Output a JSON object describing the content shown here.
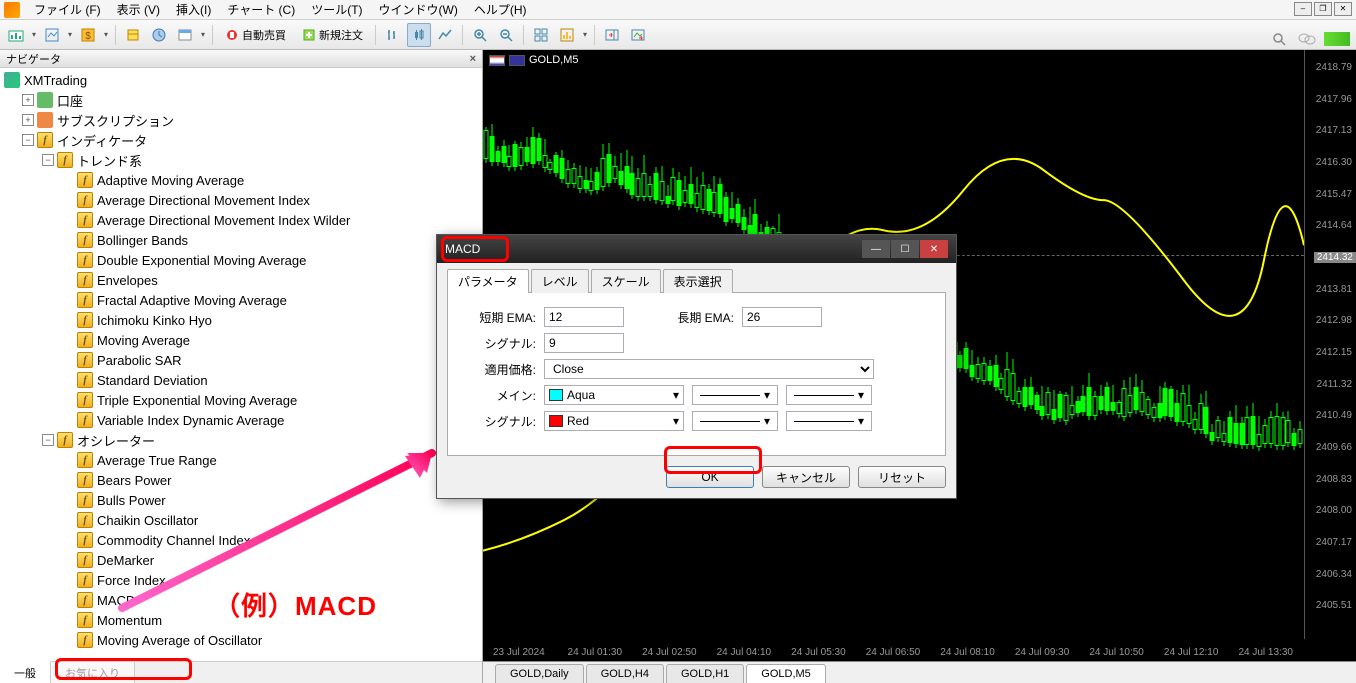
{
  "menu": {
    "items": [
      "ファイル (F)",
      "表示 (V)",
      "挿入(I)",
      "チャート (C)",
      "ツール(T)",
      "ウインドウ(W)",
      "ヘルプ(H)"
    ]
  },
  "toolbar": {
    "auto_trade": "自動売買",
    "new_order": "新規注文"
  },
  "navigator": {
    "title": "ナビゲータ",
    "root": "XMTrading",
    "account": "口座",
    "subscription": "サブスクリプション",
    "indicators": "インディケータ",
    "trend": "トレンド系",
    "oscillator": "オシレーター",
    "trend_items": [
      "Adaptive Moving Average",
      "Average Directional Movement Index",
      "Average Directional Movement Index Wilder",
      "Bollinger Bands",
      "Double Exponential Moving Average",
      "Envelopes",
      "Fractal Adaptive Moving Average",
      "Ichimoku Kinko Hyo",
      "Moving Average",
      "Parabolic SAR",
      "Standard Deviation",
      "Triple Exponential Moving Average",
      "Variable Index Dynamic Average"
    ],
    "osc_items": [
      "Average True Range",
      "Bears Power",
      "Bulls Power",
      "Chaikin Oscillator",
      "Commodity Channel Index",
      "DeMarker",
      "Force Index",
      "MACD",
      "Momentum",
      "Moving Average of Oscillator"
    ],
    "tab_general": "一般",
    "tab_favorites": "お気に入り"
  },
  "chart": {
    "title": "GOLD,M5",
    "prices": [
      "2418.79",
      "2417.96",
      "2417.13",
      "2416.30",
      "2415.47",
      "2414.64",
      "2414.32",
      "2413.81",
      "2412.98",
      "2412.15",
      "2411.32",
      "2410.49",
      "2409.66",
      "2408.83",
      "2408.00",
      "2407.17",
      "2406.34",
      "2405.51"
    ],
    "current_price": "2414.32",
    "times": [
      "23 Jul 2024",
      "24 Jul 01:30",
      "24 Jul 02:50",
      "24 Jul 04:10",
      "24 Jul 05:30",
      "24 Jul 06:50",
      "24 Jul 08:10",
      "24 Jul 09:30",
      "24 Jul 10:50",
      "24 Jul 12:10",
      "24 Jul 13:30"
    ],
    "tabs": [
      "GOLD,Daily",
      "GOLD,H4",
      "GOLD,H1",
      "GOLD,M5"
    ],
    "active_tab": "GOLD,M5"
  },
  "dialog": {
    "title": "MACD",
    "tabs": [
      "パラメータ",
      "レベル",
      "スケール",
      "表示選択"
    ],
    "lbl_fast_ema": "短期 EMA:",
    "val_fast_ema": "12",
    "lbl_slow_ema": "長期 EMA:",
    "val_slow_ema": "26",
    "lbl_signal": "シグナル:",
    "val_signal": "9",
    "lbl_apply": "適用価格:",
    "val_apply": "Close",
    "lbl_main": "メイン:",
    "val_main_color": "Aqua",
    "lbl_signal2": "シグナル:",
    "val_signal_color": "Red",
    "btn_ok": "OK",
    "btn_cancel": "キャンセル",
    "btn_reset": "リセット"
  },
  "annotation": {
    "text": "（例）MACD"
  },
  "chart_data": {
    "type": "candlestick",
    "symbol": "GOLD",
    "timeframe": "M5",
    "y_range": [
      2405.51,
      2418.79
    ],
    "overlay": "Moving Average (yellow)",
    "note": "Approximate OHLC candlestick data read from a 5-minute gold chart; values estimated from gridlines."
  }
}
